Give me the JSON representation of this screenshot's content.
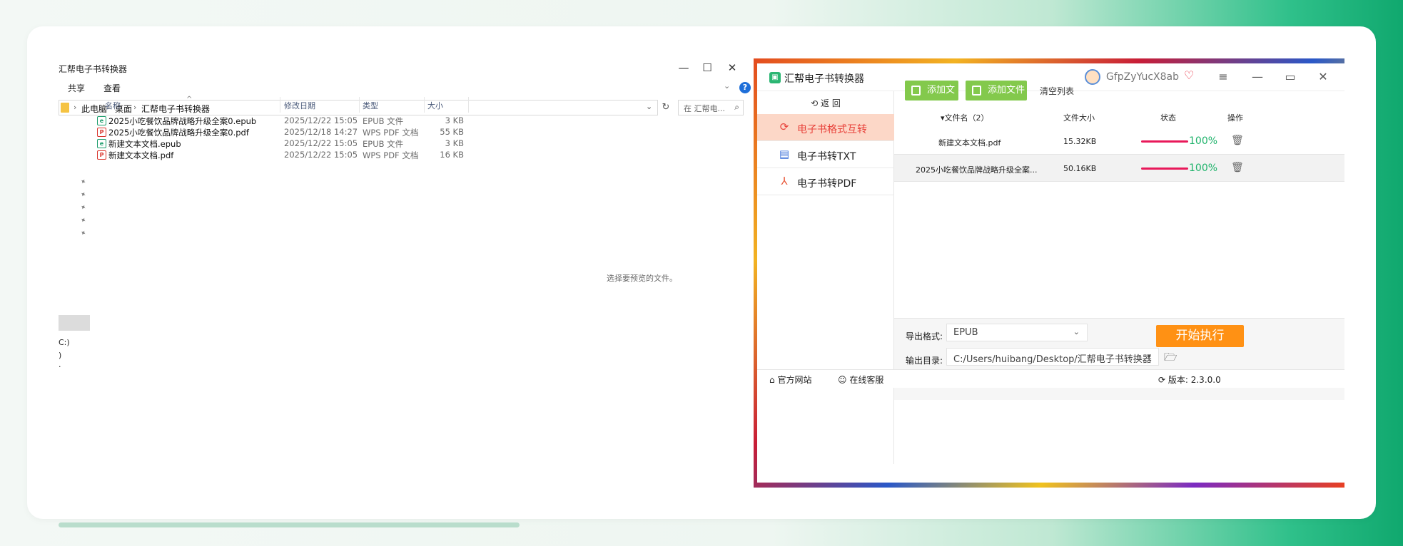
{
  "explorer": {
    "title": "汇帮电子书转换器",
    "win_controls": {
      "minimize": "—",
      "maximize": "☐",
      "close": "✕"
    },
    "menu": [
      "共享",
      "查看"
    ],
    "help": "?",
    "breadcrumb": [
      "此电脑",
      "桌面",
      "汇帮电子书转换器"
    ],
    "search_placeholder": "在 汇帮电...",
    "columns": {
      "name": "名称",
      "date": "修改日期",
      "type": "类型",
      "size": "大小"
    },
    "files": [
      {
        "name": "2025小吃餐饮品牌战略升级全案0.epub",
        "date": "2025/12/22 15:05",
        "type": "EPUB 文件",
        "size": "3 KB",
        "kind": "epub"
      },
      {
        "name": "2025小吃餐饮品牌战略升级全案0.pdf",
        "date": "2025/12/18 14:27",
        "type": "WPS PDF 文档",
        "size": "55 KB",
        "kind": "pdf"
      },
      {
        "name": "新建文本文档.epub",
        "date": "2025/12/22 15:05",
        "type": "EPUB 文件",
        "size": "3 KB",
        "kind": "epub"
      },
      {
        "name": "新建文本文档.pdf",
        "date": "2025/12/22 15:05",
        "type": "WPS PDF 文档",
        "size": "16 KB",
        "kind": "pdf"
      }
    ],
    "nav_fragments": [
      "C:)",
      ")",
      "·"
    ],
    "preview_text": "选择要预览的文件。"
  },
  "app": {
    "title": "汇帮电子书转换器",
    "username": "GfpZyYucX8ab",
    "back_label": "返  回",
    "sidebar": [
      {
        "label": "电子书格式互转",
        "icon": "refresh-icon",
        "active": true
      },
      {
        "label": "电子书转TXT",
        "icon": "document-icon",
        "active": false
      },
      {
        "label": "电子书转PDF",
        "icon": "acrobat-icon",
        "active": false
      }
    ],
    "toolbar": {
      "add_file": "添加文件",
      "add_folder": "添加文件夹",
      "clear": "清空列表"
    },
    "table_headers": {
      "name": "文件名（2）",
      "size": "文件大小",
      "status": "状态",
      "action": "操作"
    },
    "rows": [
      {
        "name": "新建文本文档.pdf",
        "size": "15.32KB",
        "progress": 100,
        "progress_text": "100%"
      },
      {
        "name": "2025小吃餐饮品牌战略升级全案...",
        "size": "50.16KB",
        "progress": 100,
        "progress_text": "100%"
      }
    ],
    "export_format_label": "导出格式:",
    "export_format_value": "EPUB",
    "output_dir_label": "输出目录:",
    "output_dir_value": "C:/Users/huibang/Desktop/汇帮电子书转换器",
    "start_button": "开始执行",
    "footer": {
      "website": "官方网站",
      "support": "在线客服",
      "version": "版本:  2.3.0.0"
    },
    "colors": {
      "accent_orange": "#ff9114",
      "green_button": "#83c94c",
      "active_bg": "#fcd7c7",
      "progress_bar": "#e8195a",
      "progress_text": "#1fb36b"
    }
  }
}
